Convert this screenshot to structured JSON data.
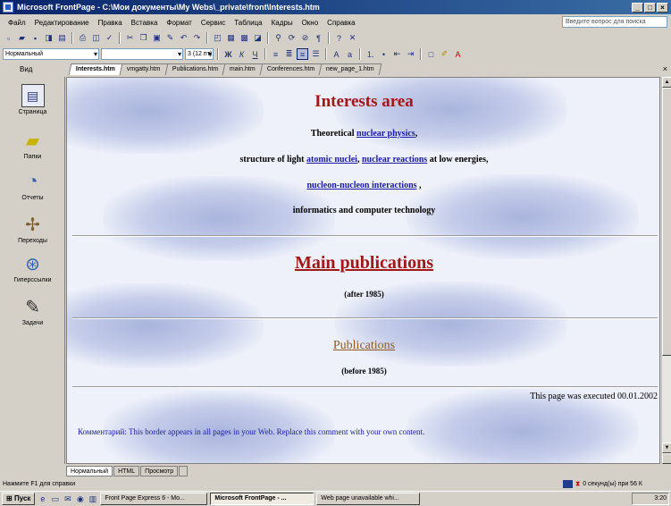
{
  "window": {
    "title": "Microsoft FrontPage - C:\\Мои документы\\My Webs\\_private\\front\\Interests.htm",
    "min": "_",
    "max": "□",
    "close": "×"
  },
  "menu": {
    "items": [
      "Файл",
      "Редактирование",
      "Правка",
      "Вставка",
      "Формат",
      "Сервис",
      "Таблица",
      "Кадры",
      "Окно",
      "Справка"
    ],
    "help_placeholder": "Введите вопрос для поиска"
  },
  "toolbar": {
    "style_value": "Нормальный",
    "font_value": "",
    "size_value": "3 (12 пт)"
  },
  "tabs": {
    "views_label": "Вид",
    "documents": [
      "Interests.htm",
      "vmgatty.htm",
      "Publications.htm",
      "main.htm",
      "Conferences.htm",
      "new_page_1.htm"
    ],
    "active_index": 0
  },
  "views": [
    {
      "label": "Страница",
      "icon": "page-view-icon"
    },
    {
      "label": "Папки",
      "icon": "folders-icon"
    },
    {
      "label": "Отчеты",
      "icon": "reports-icon"
    },
    {
      "label": "Переходы",
      "icon": "navigation-icon"
    },
    {
      "label": "Гиперссылки",
      "icon": "hyperlinks-icon"
    },
    {
      "label": "Задачи",
      "icon": "tasks-icon"
    }
  ],
  "page": {
    "interests_heading": "Interests area",
    "line1_prefix": "Theoretical ",
    "line1_link": "nuclear physics",
    "line1_suffix": ",",
    "line2_prefix": "structure of light ",
    "line2_link1": "atomic nuclei",
    "line2_mid": ", ",
    "line2_link2": "nuclear reactions",
    "line2_suffix": " at low energies,",
    "line3_link": "nucleon-nucleon interactions",
    "line3_suffix": " ,",
    "line4": "informatics and computer technology",
    "publications_heading": "Main publications",
    "after_1985": "(after 1985)",
    "publications_link": "Publications",
    "before_1985": "(before 1985)",
    "executed": "This page was executed 00.01.2002",
    "comment": "Комментарий: This border appears in all pages in your Web. Replace this comment with your own content."
  },
  "bottom_tabs": [
    "Нормальный",
    "HTML",
    "Просмотр"
  ],
  "status": {
    "left": "Нажмите F1 для справки",
    "right": "0 секунд(ы) при 56 К"
  },
  "taskbar": {
    "start": "Пуск",
    "tasks": [
      "Front Page Express 6 - Mo...",
      "Microsoft FrontPage - ...",
      "Web page unavailable whi..."
    ],
    "active_index": 1,
    "clock": "3:20"
  }
}
